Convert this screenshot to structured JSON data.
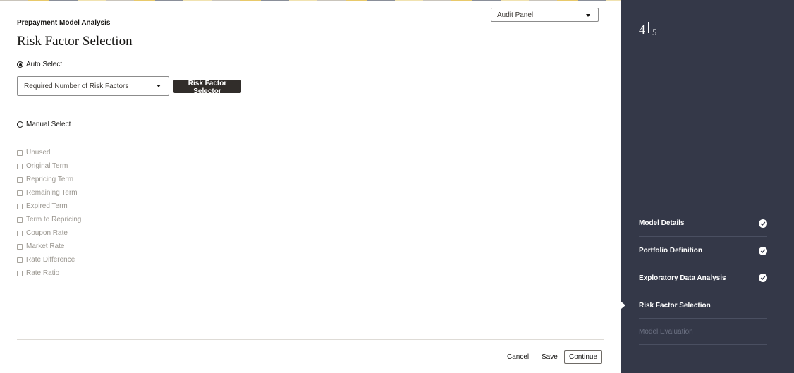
{
  "header": {
    "breadcrumb": "Prepayment Model Analysis",
    "title": "Risk Factor Selection",
    "audit_panel": {
      "selected": "Audit Panel"
    }
  },
  "auto_select": {
    "label": "Auto Select",
    "checked": true,
    "risk_factor_count_select": {
      "selected": "Required Number of Risk Factors"
    },
    "selector_button": "Risk Factor Selector"
  },
  "manual_select": {
    "label": "Manual Select",
    "checked": false,
    "factors": [
      {
        "label": "Unused"
      },
      {
        "label": "Original Term"
      },
      {
        "label": "Repricing Term"
      },
      {
        "label": "Remaining Term"
      },
      {
        "label": "Expired Term"
      },
      {
        "label": "Term to Repricing"
      },
      {
        "label": "Coupon Rate"
      },
      {
        "label": "Market Rate"
      },
      {
        "label": "Rate Difference"
      },
      {
        "label": "Rate Ratio"
      }
    ]
  },
  "footer": {
    "cancel": "Cancel",
    "save": "Save",
    "continue": "Continue"
  },
  "sidebar": {
    "step_current": "4",
    "step_total": "5",
    "steps": [
      {
        "label": "Model Details",
        "status": "complete"
      },
      {
        "label": "Portfolio Definition",
        "status": "complete"
      },
      {
        "label": "Exploratory Data Analysis",
        "status": "complete"
      },
      {
        "label": "Risk Factor Selection",
        "status": "current"
      },
      {
        "label": "Model Evaluation",
        "status": "pending"
      }
    ]
  },
  "icons": {
    "caret": "chevron-down-icon",
    "check": "check-circle-icon"
  },
  "colors": {
    "sidebar_bg": "#343848",
    "primary_button": "#312d2a"
  }
}
